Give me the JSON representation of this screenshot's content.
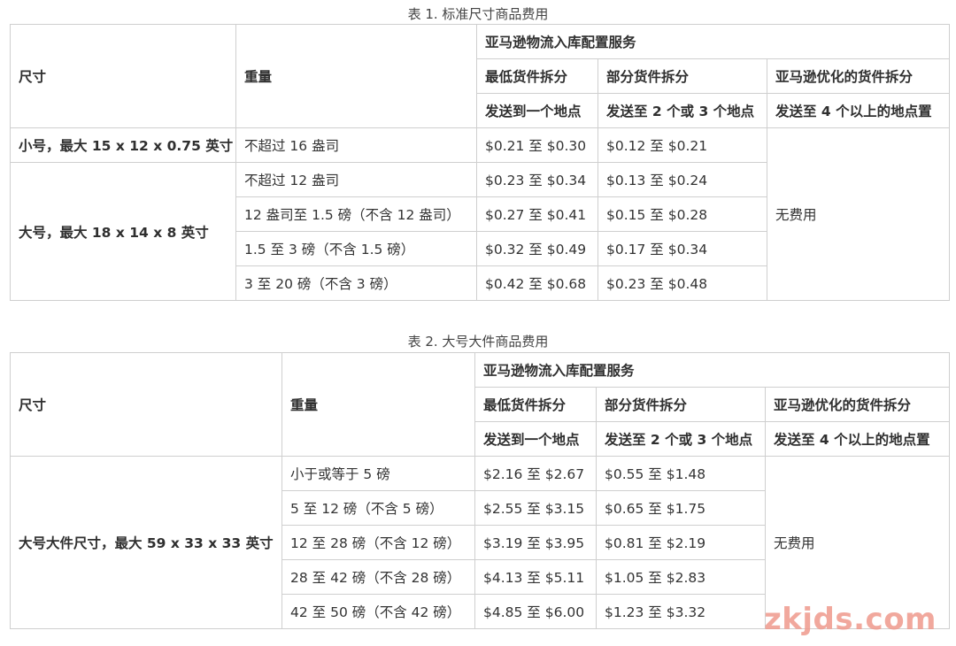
{
  "table1": {
    "caption": "表 1. 标准尺寸商品费用",
    "header": {
      "size": "尺寸",
      "weight": "重量",
      "service": "亚马逊物流入库配置服务",
      "col_min": "最低货件拆分",
      "col_partial": "部分货件拆分",
      "col_opt": "亚马逊优化的货件拆分",
      "sub_min": "发送到一个地点",
      "sub_partial": "发送至 2 个或 3 个地点",
      "sub_opt": "发送至 4 个以上的地点置"
    },
    "small_size": "小号，最大 15 x 12 x 0.75 英寸",
    "large_size": "大号，最大 18 x 14 x 8 英寸",
    "no_fee": "无费用",
    "rows": [
      {
        "weight": "不超过 16 盎司",
        "min": "$0.21 至 $0.30",
        "partial": "$0.12 至 $0.21"
      },
      {
        "weight": "不超过 12 盎司",
        "min": "$0.23 至 $0.34",
        "partial": "$0.13 至 $0.24"
      },
      {
        "weight": "12 盎司至 1.5 磅（不含 12 盎司）",
        "min": "$0.27 至 $0.41",
        "partial": "$0.15 至 $0.28"
      },
      {
        "weight": "1.5 至 3 磅（不含 1.5 磅）",
        "min": "$0.32 至 $0.49",
        "partial": "$0.17 至 $0.34"
      },
      {
        "weight": "3 至 20 磅（不含 3 磅）",
        "min": "$0.42 至 $0.68",
        "partial": "$0.23 至 $0.48"
      }
    ]
  },
  "table2": {
    "caption": "表 2. 大号大件商品费用",
    "header": {
      "size": "尺寸",
      "weight": "重量",
      "service": "亚马逊物流入库配置服务",
      "col_min": "最低货件拆分",
      "col_partial": "部分货件拆分",
      "col_opt": "亚马逊优化的货件拆分",
      "sub_min": "发送到一个地点",
      "sub_partial": "发送至 2 个或 3 个地点",
      "sub_opt": "发送至 4 个以上的地点置"
    },
    "size": "大号大件尺寸，最大 59 x 33 x 33 英寸",
    "no_fee": "无费用",
    "rows": [
      {
        "weight": "小于或等于 5 磅",
        "min": "$2.16 至 $2.67",
        "partial": "$0.55 至 $1.48"
      },
      {
        "weight": "5 至 12 磅（不含 5 磅）",
        "min": "$2.55 至 $3.15",
        "partial": "$0.65 至 $1.75"
      },
      {
        "weight": "12 至 28 磅（不含 12 磅）",
        "min": "$3.19 至 $3.95",
        "partial": "$0.81 至 $2.19"
      },
      {
        "weight": "28 至 42 磅（不含 28 磅）",
        "min": "$4.13 至 $5.11",
        "partial": "$1.05 至 $2.83"
      },
      {
        "weight": "42 至 50 磅（不含 42 磅）",
        "min": "$4.85 至 $6.00",
        "partial": "$1.23 至 $3.32"
      }
    ]
  },
  "watermark": "zkjds.com"
}
